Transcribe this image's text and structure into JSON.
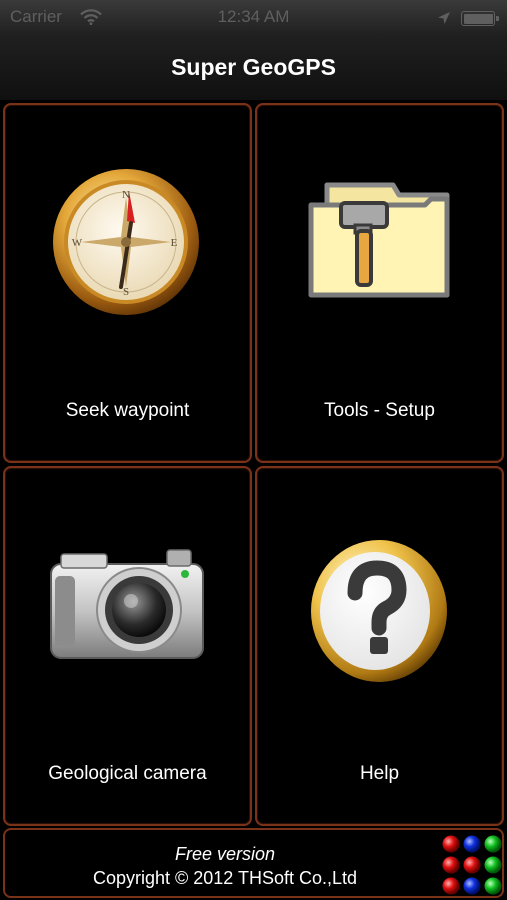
{
  "status_bar": {
    "carrier": "Carrier",
    "time": "12:34 AM",
    "battery_level": 1.0
  },
  "title": "Super GeoGPS",
  "tiles": [
    {
      "label": "Seek waypoint",
      "icon": "compass-icon"
    },
    {
      "label": "Tools - Setup",
      "icon": "tools-folder-icon"
    },
    {
      "label": "Geological camera",
      "icon": "camera-icon"
    },
    {
      "label": "Help",
      "icon": "help-icon"
    }
  ],
  "footer": {
    "edition": "Free version",
    "copyright": "Copyright © 2012 THSoft Co.,Ltd"
  },
  "compass_letters": {
    "n": "N",
    "e": "E",
    "s": "S",
    "w": "W"
  },
  "colors": {
    "tile_border": "#7a3318",
    "background": "#000000"
  }
}
